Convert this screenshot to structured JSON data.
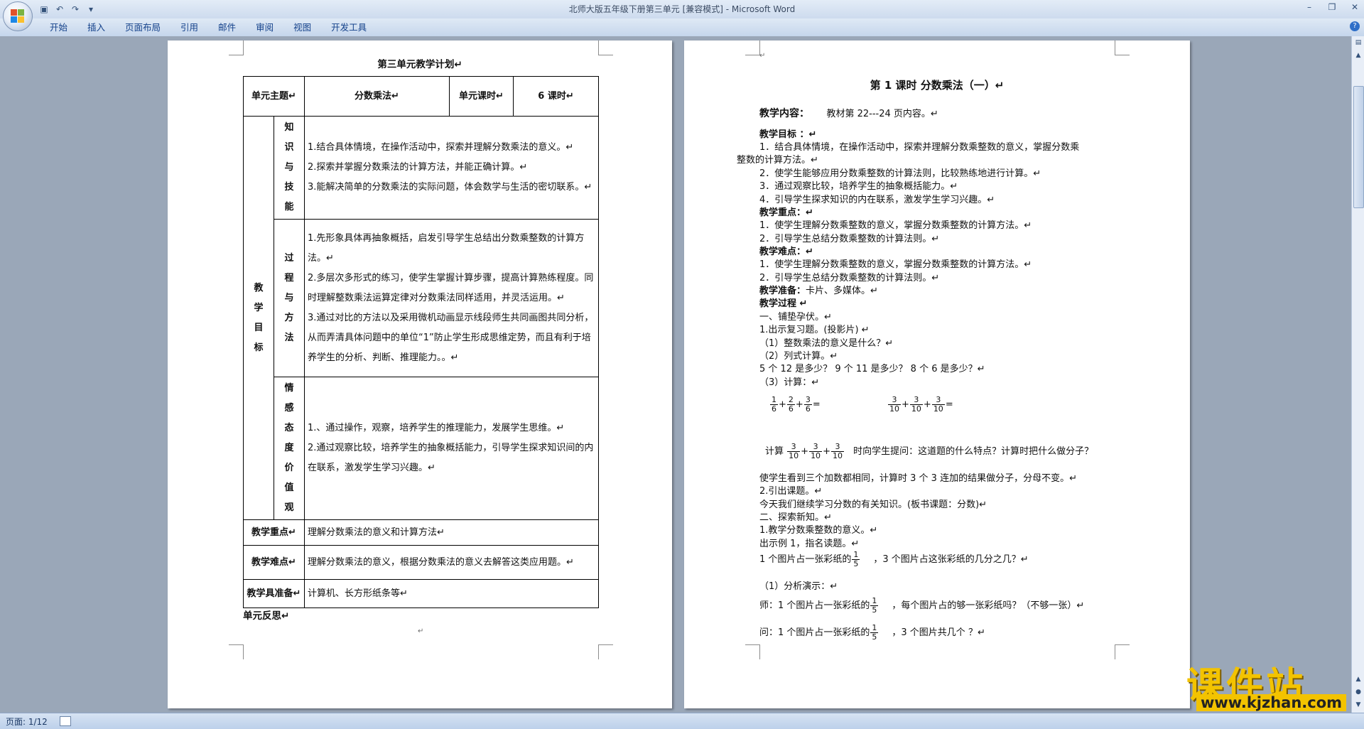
{
  "window": {
    "title": "北师大版五年级下册第三单元 [兼容模式] - Microsoft Word"
  },
  "ribbon": {
    "tabs": [
      "开始",
      "插入",
      "页面布局",
      "引用",
      "邮件",
      "审阅",
      "视图",
      "开发工具"
    ]
  },
  "status": {
    "page": "页面: 1/12"
  },
  "watermark": {
    "text": "课件站",
    "url": "www.kjzhan.com"
  },
  "page1": {
    "title": "第三单元教学计划↵",
    "table": {
      "unit_theme_label": "单元主题↵",
      "unit_theme": "分数乘法↵",
      "unit_hours_label": "单元课时↵",
      "unit_hours": "6 课时↵",
      "goals_label": [
        "教",
        "学",
        "目",
        "标"
      ],
      "knowledge_label": [
        "知",
        "识",
        "与",
        "技",
        "能"
      ],
      "knowledge_text": [
        "1.结合具体情境，在操作活动中，探索并理解分数乘法的意义。↵",
        "2.探索并掌握分数乘法的计算方法，并能正确计算。↵",
        "3.能解决简单的分数乘法的实际问题，体会数学与生活的密切联系。↵"
      ],
      "process_label": [
        "过",
        "程",
        "与",
        "方",
        "法"
      ],
      "process_text": [
        "1.先形象具体再抽象概括，启发引导学生总结出分数乘整数的计算方法。↵",
        "2.多层次多形式的练习，使学生掌握计算步骤，提高计算熟练程度。同时理解整数乘法运算定律对分数乘法同样适用，并灵活运用。↵",
        "3.通过对比的方法以及采用微机动画显示线段师生共同画图共同分析，从而弄清具体问题中的单位“1”防止学生形成思维定势，而且有利于培养学生的分析、判断、推理能力。。↵"
      ],
      "emotion_label": [
        "情",
        "感",
        "态",
        "度",
        "价",
        "值",
        "观"
      ],
      "emotion_text": [
        "1.、通过操作，观察，培养学生的推理能力，发展学生思维。↵",
        "2.通过观察比较，培养学生的抽象概括能力，引导学生探求知识间的内在联系，激发学生学习兴趣。↵"
      ],
      "key_label": "教学重点↵",
      "key_text": "理解分数乘法的意义和计算方法↵",
      "difficulty_label": "教学难点↵",
      "difficulty_text": "理解分数乘法的意义，根据分数乘法的意义去解答这类应用题。↵",
      "tools_label": "教学具准备↵",
      "tools_text": "计算机、长方形纸条等↵"
    },
    "reflection": "单元反思↵"
  },
  "page2": {
    "heading": "第 1 课时  分数乘法（一）↵",
    "content_label": "教学内容：",
    "content_text": "教材第  22---24 页内容。↵",
    "objectives_label": "教学目标  ：↵",
    "obj1a": "1．结合具体情境，在操作活动中，探索并理解分数乘整数的意义，掌握分数乘",
    "obj1b": "整数的计算方法。↵",
    "obj2": "2．使学生能够应用分数乘整数的计算法则，比较熟练地进行计算。↵",
    "obj3": "3．通过观察比较，培养学生的抽象概括能力。↵",
    "obj4": "4．引导学生探求知识的内在联系，激发学生学习兴趣。↵",
    "key_label": "教学重点：↵",
    "key1": "1．使学生理解分数乘整数的意义，掌握分数乘整数的计算方法。↵",
    "key2": "2．引导学生总结分数乘整数的计算法则。↵",
    "diff_label": "教学难点：↵",
    "diff1": "1．使学生理解分数乘整数的意义，掌握分数乘整数的计算方法。↵",
    "diff2": "2．引导学生总结分数乘整数的计算法则。↵",
    "prep_label": "教学准备：",
    "prep_text": "卡片、多媒体。↵",
    "process_label": "教学过程  ↵",
    "s1": "一、铺垫孕伏。↵",
    "s1_1": "1.出示复习题。(投影片)  ↵",
    "s1_q1": "（1）整数乘法的意义是什么？↵",
    "s1_q2": "（2）列式计算。↵",
    "s1_q2_text": "5 个 12 是多少？    9 个 11 是多少？    8 个 6 是多少？↵",
    "s1_q3": "（3）计算：↵",
    "calc1_fracs": [
      [
        "1",
        "6"
      ],
      [
        "2",
        "6"
      ],
      [
        "3",
        "6"
      ]
    ],
    "calc2_fracs": [
      [
        "3",
        "10"
      ],
      [
        "3",
        "10"
      ],
      [
        "3",
        "10"
      ]
    ],
    "calc_prefix": "计算",
    "calc_suffix": "时向学生提问：这道题的什么特点？计算时把什么做分子？",
    "s1_obs": "使学生看到三个加数都相同，计算时 3 个 3 连加的结果做分子，分母不变。↵",
    "s1_2": "2.引出课题。↵",
    "s1_3": "今天我们继续学习分数的有关知识。(板书课题：分数)↵",
    "s2": "二、探索新知。↵",
    "s2_1": "1.教学分数乘整数的意义。↵",
    "s2_ex": "出示例 1，指名读题。↵",
    "ex_a": "1 个图片占一张彩纸的",
    "ex_b": "，3 个图片占这张彩纸的几分之几？↵",
    "analysis": "（1）分析演示：↵",
    "teacher_a": "师：1 个图片占一张彩纸的",
    "teacher_b": "，每个图片占的够一张彩纸吗？（不够一张）↵",
    "ask_a": "问：1 个图片占一张彩纸的",
    "ask_b": "，3 个图片共几个  ？↵",
    "frac_one_fifth": [
      "1",
      "5"
    ],
    "plus": "+",
    "eq": "=",
    "page_mark": "↵"
  }
}
